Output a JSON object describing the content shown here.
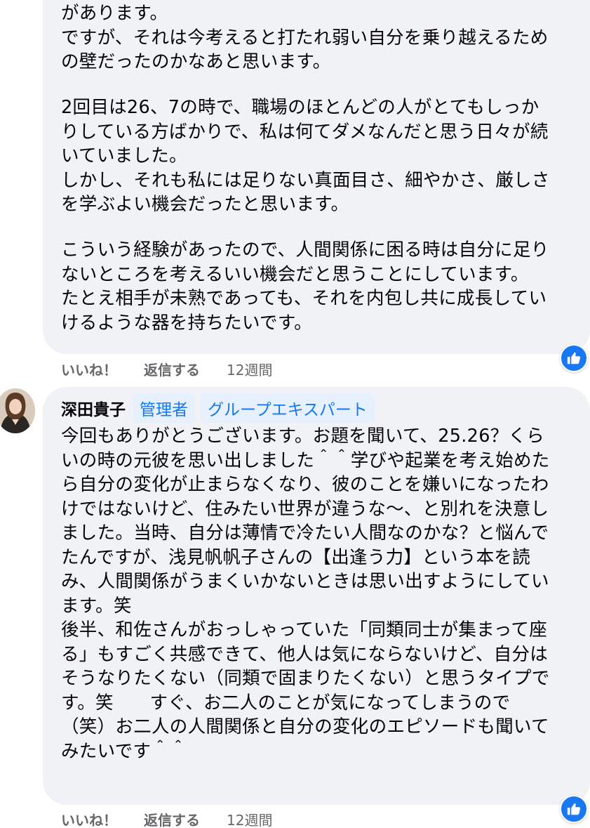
{
  "comment1": {
    "paragraphs": [
      "があります。\nですが、それは今考えると打たれ弱い自分を乗り越えるため\nの壁だったのかなあと思います。",
      "2回目は26、7の時で、職場のほとんどの人がとてもしっか\nりしている方ばかりで、私は何てダメなんだと思う日々が続\nいていました。\nしかし、それも私には足りない真面目さ、細やかさ、厳しさ\nを学ぶよい機会だったと思います。",
      "こういう経験があったので、人間関係に困る時は自分に足り\nないところを考えるいい機会だと思うことにしています。\nたとえ相手が未熟であっても、それを内包し共に成長してい\nけるような器を持ちたいです。"
    ],
    "actions": {
      "like": "いいね！",
      "reply": "返信する",
      "time": "12週間"
    },
    "reaction_icon": "thumbs-up-icon"
  },
  "comment2": {
    "author": "深田貴子",
    "badges": [
      "管理者",
      "グループエキスパート"
    ],
    "text": "今回もありがとうございます。お題を聞いて、25.26？くら\nいの時の元彼を思い出しました＾＾学びや起業を考え始めた\nら自分の変化が止まらなくなり、彼のことを嫌いになったわ\nけではないけど、住みたい世界が違うな〜、と別れを決意し\nました。当時、自分は薄情で冷たい人間なのかな？と悩んで\nたんですが、浅見帆帆子さんの【出逢う力】という本を読\nみ、人間関係がうまくいかないときは思い出すようにしてい\nます。笑\n後半、和佐さんがおっしゃっていた「同類同士が集まって座\nる」もすごく共感できて、他人は気にならないけど、自分は\nそうなりたくない（同類で固まりたくない）と思うタイプで\nす。笑　　すぐ、お二人のことが気になってしまうので\n（笑）お二人の人間関係と自分の変化のエピソードも聞いて\nみたいです＾＾",
    "actions": {
      "like": "いいね！",
      "reply": "返信する",
      "time": "12週間"
    },
    "reaction_icon": "thumbs-up-icon"
  },
  "colors": {
    "bubble": "#f0f2f5",
    "accent": "#1877f2",
    "secondary_text": "#65676b",
    "badge_bg": "#e7f0fd"
  }
}
